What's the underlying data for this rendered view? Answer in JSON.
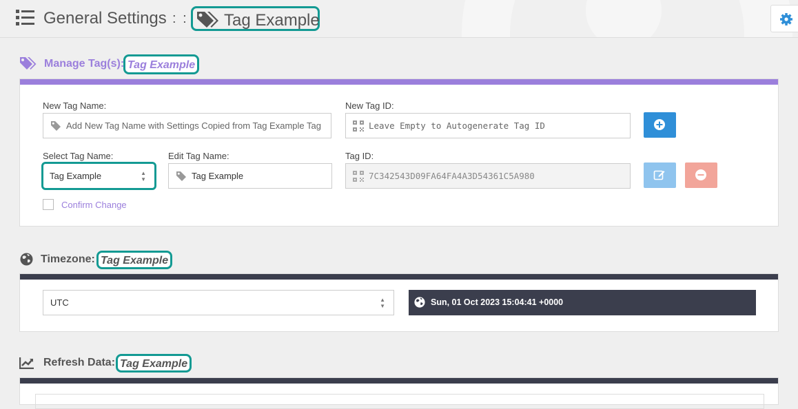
{
  "header": {
    "title": "General Settings",
    "separator": ": :",
    "tag_name": "Tag Example"
  },
  "manage_tags": {
    "title": "Manage Tag(s):",
    "tag_highlight": "Tag Example",
    "accent_color": "#9b7fdc",
    "new_tag_name_label": "New Tag Name:",
    "new_tag_name_placeholder": "Add New Tag Name with Settings Copied from Tag Example Tag",
    "new_tag_id_label": "New Tag ID:",
    "new_tag_id_placeholder": "Leave Empty to Autogenerate Tag ID",
    "select_tag_label": "Select Tag Name:",
    "select_tag_value": "Tag Example",
    "edit_tag_label": "Edit Tag Name:",
    "edit_tag_value": "Tag Example",
    "tag_id_label": "Tag ID:",
    "tag_id_value": "7C342543D09FA64FA4A3D54361C5A980",
    "confirm_change_label": "Confirm Change"
  },
  "timezone": {
    "title": "Timezone:",
    "tag_highlight": "Tag Example",
    "selected": "UTC",
    "current_time": "Sun, 01 Oct 2023 15:04:41 +0000"
  },
  "refresh_data": {
    "title": "Refresh Data:",
    "tag_highlight": "Tag Example"
  },
  "colors": {
    "highlight_border": "#139a93",
    "primary_button": "#2f8fd8",
    "edit_button": "#8fc4ee",
    "delete_button": "#f2a59a",
    "dark_bar": "#3b3e4d"
  }
}
